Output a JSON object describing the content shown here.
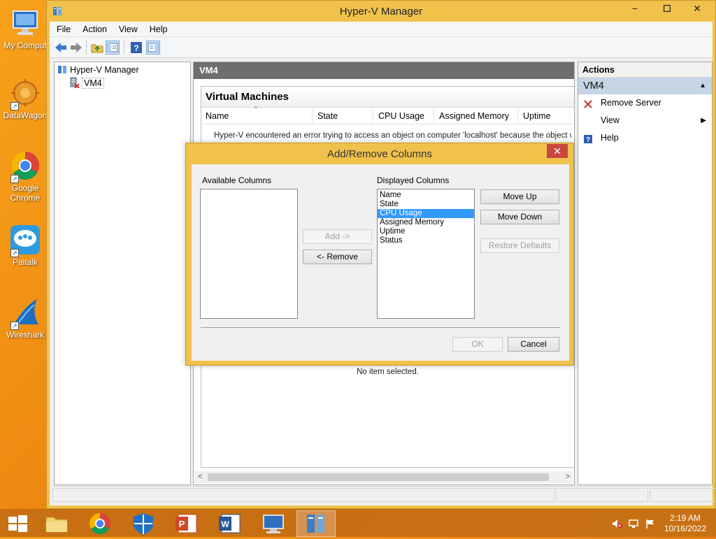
{
  "desktop": {
    "icons": [
      {
        "label": "My Comput",
        "icon": "computer-icon"
      },
      {
        "label": "DataWagon",
        "icon": "datawagon-icon"
      },
      {
        "label": "Google Chrome",
        "icon": "chrome-icon"
      },
      {
        "label": "Paltalk",
        "icon": "paltalk-icon"
      },
      {
        "label": "Wireshark",
        "icon": "wireshark-icon"
      }
    ]
  },
  "window": {
    "title": "Hyper-V Manager",
    "menu": [
      "File",
      "Action",
      "View",
      "Help"
    ],
    "tree": {
      "root": "Hyper-V Manager",
      "child": "VM4"
    },
    "center": {
      "header": "VM4",
      "section_title": "Virtual Machines",
      "columns": [
        "Name",
        "State",
        "CPU Usage",
        "Assigned Memory",
        "Uptime"
      ],
      "error_text": "Hyper-V encountered an error trying to access an object on computer 'localhost' because the object was not",
      "no_item_text": "No item selected."
    },
    "actions": {
      "header": "Actions",
      "selected": "VM4",
      "items": [
        {
          "label": "Remove Server",
          "icon": "remove-x-icon"
        },
        {
          "label": "View",
          "icon": ""
        },
        {
          "label": "Help",
          "icon": "help-icon"
        }
      ]
    }
  },
  "dialog": {
    "title": "Add/Remove Columns",
    "available_label": "Available Columns",
    "available_items": [],
    "displayed_label": "Displayed Columns",
    "displayed_items": [
      "Name",
      "State",
      "CPU Usage",
      "Assigned Memory",
      "Uptime",
      "Status"
    ],
    "selected_item": "CPU Usage",
    "buttons": {
      "add": "Add ->",
      "remove": "<- Remove",
      "move_up": "Move Up",
      "move_down": "Move Down",
      "restore": "Restore Defaults",
      "ok": "OK",
      "cancel": "Cancel"
    }
  },
  "taskbar": {
    "time": "2:19 AM",
    "date": "10/16/2022"
  },
  "colors": {
    "window_frame": "#f0c24c",
    "selection": "#3399ff",
    "close_button": "#c9473d",
    "pane_header": "#6e6e6e"
  }
}
